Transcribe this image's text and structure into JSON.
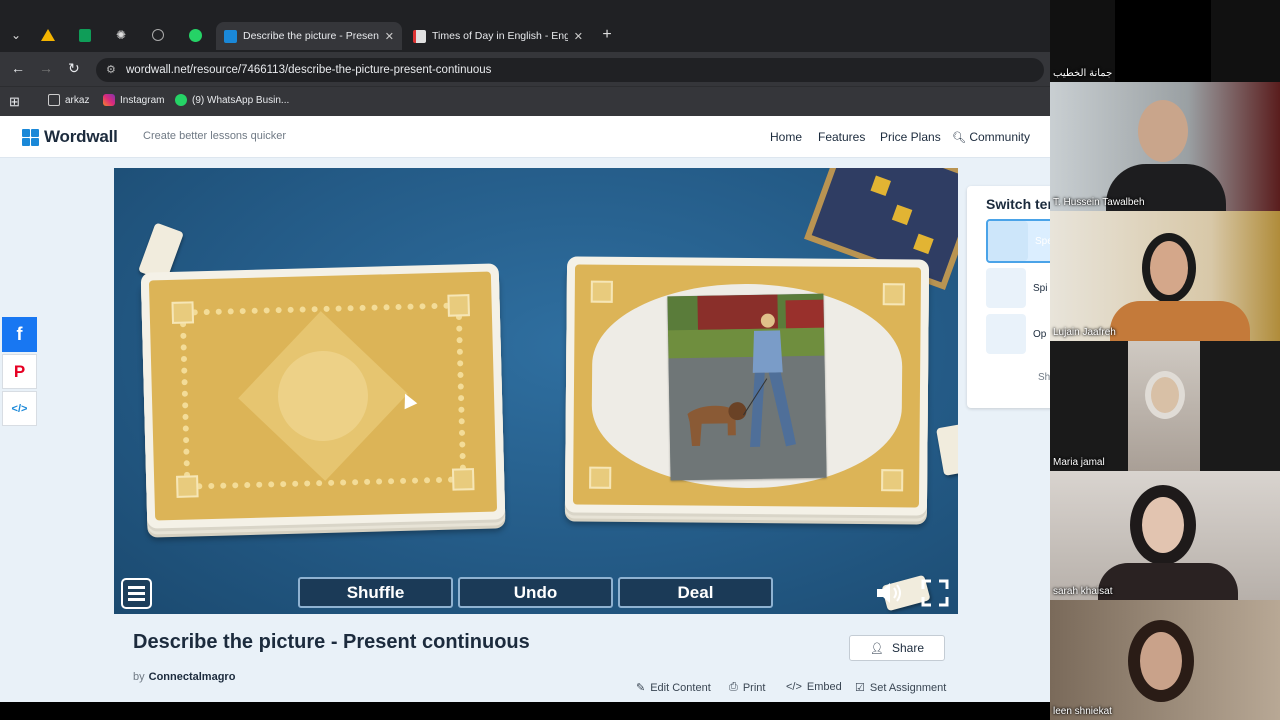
{
  "browser": {
    "tabs": [
      {
        "title": "Describe the picture - Present c",
        "active": true
      },
      {
        "title": "Times of Day in English - Englis",
        "active": false
      }
    ],
    "url": "wordwall.net/resource/7466113/describe-the-picture-present-continuous",
    "bookmarks": [
      "arkaz",
      "Instagram",
      "(9) WhatsApp Busin..."
    ]
  },
  "site": {
    "brand": "Wordwall",
    "tagline": "Create better lessons quicker",
    "nav": [
      "Home",
      "Features",
      "Price Plans",
      "Community"
    ]
  },
  "game": {
    "buttons": {
      "shuffle": "Shuffle",
      "undo": "Undo",
      "deal": "Deal"
    }
  },
  "switch_panel": {
    "title": "Switch ter",
    "items": [
      "Spe",
      "Spi",
      "Op"
    ],
    "footer": "Sh"
  },
  "activity": {
    "title": "Describe the picture - Present continuous",
    "by_prefix": "by",
    "author": "Connectalmagro",
    "share": "Share",
    "actions": [
      "Edit Content",
      "Print",
      "Embed",
      "Set Assignment"
    ]
  },
  "participants": [
    "جمانة الخطيب",
    "T. Hussein Tawalbeh",
    "Lujain Jaafreh",
    "Maria jamal",
    "sarah khaisat",
    "leen shniekat"
  ],
  "colors": {
    "brand": "#1a88d8",
    "game_bg": "#245b87",
    "card_gold": "#dcb457"
  }
}
